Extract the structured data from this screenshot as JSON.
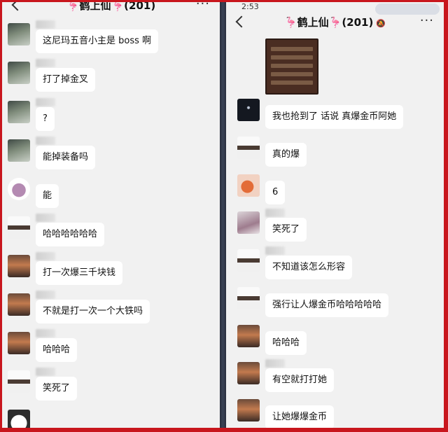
{
  "left": {
    "title_crane_left": "🦩",
    "title_name": "鹤上仙",
    "title_crane_right": "🦩",
    "title_count": "(201)",
    "more": "···",
    "messages": [
      {
        "text": "这尼玛五音小主是 boss 啊",
        "avatar": "dark"
      },
      {
        "text": "打了掉金叉",
        "avatar": "dark"
      },
      {
        "text": "?",
        "avatar": "dark"
      },
      {
        "text": "能掉装备吗",
        "avatar": "dark"
      },
      {
        "text": "能",
        "avatar": "pink"
      },
      {
        "text": "哈哈哈哈哈哈",
        "avatar": "cat"
      },
      {
        "text": "打一次爆三千块钱",
        "avatar": "sunset"
      },
      {
        "text": "不就是打一次一个大铁吗",
        "avatar": "sunset"
      },
      {
        "text": "哈哈哈",
        "avatar": "sunset"
      },
      {
        "text": "笑死了",
        "avatar": "cat"
      }
    ]
  },
  "right": {
    "status_time": "2:53",
    "watermark": "",
    "title_crane_left": "🦩",
    "title_name": "鹤上仙",
    "title_crane_right": "🦩",
    "title_count": "(201)",
    "more": "···",
    "messages": [
      {
        "text": "我也抢到了 话说 真爆金币阿她",
        "avatar": "night"
      },
      {
        "text": "真的爆",
        "avatar": "cat"
      },
      {
        "text": "6",
        "avatar": "face"
      },
      {
        "text": "笑死了",
        "avatar": "pet"
      },
      {
        "text": "不知道该怎么形容",
        "avatar": "cat"
      },
      {
        "text": "强行让人爆金币哈哈哈哈哈",
        "avatar": "cat"
      },
      {
        "text": "哈哈哈",
        "avatar": "sunset"
      },
      {
        "text": "有空就打打她",
        "avatar": "sunset"
      },
      {
        "text": "让她爆爆金币",
        "avatar": "sunset"
      }
    ]
  }
}
